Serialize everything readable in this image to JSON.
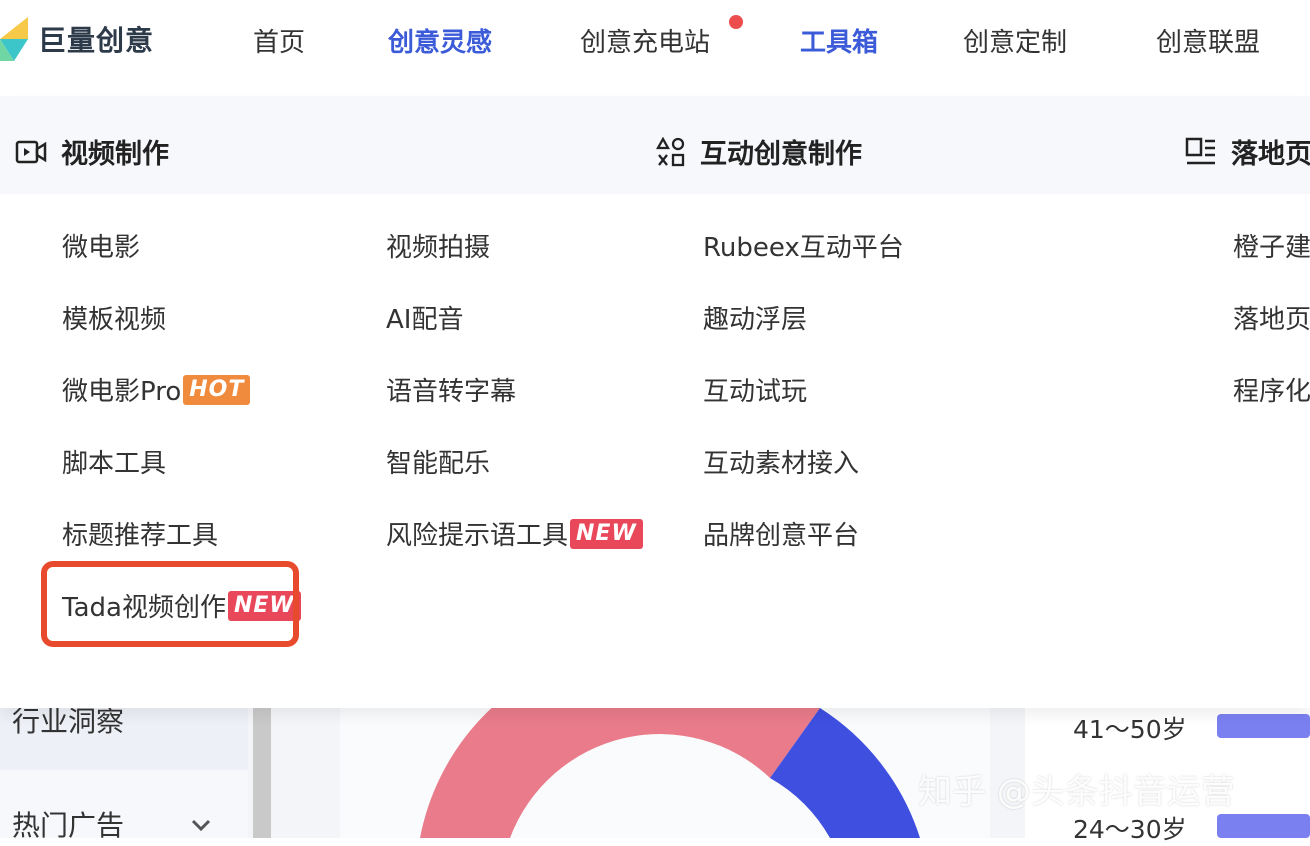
{
  "brand": {
    "name": "巨量创意"
  },
  "nav": [
    {
      "label": "首页",
      "active": false
    },
    {
      "label": "创意灵感",
      "active": true
    },
    {
      "label": "创意充电站",
      "active": false,
      "dot": true
    },
    {
      "label": "工具箱",
      "active": true
    },
    {
      "label": "创意定制",
      "active": false
    },
    {
      "label": "创意联盟",
      "active": false
    }
  ],
  "dropdown": {
    "categories": [
      {
        "label": "视频制作",
        "icon": "video-icon"
      },
      {
        "label": "互动创意制作",
        "icon": "shapes-icon"
      },
      {
        "label": "落地页",
        "icon": "layout-icon"
      }
    ],
    "col1": [
      {
        "label": "微电影"
      },
      {
        "label": "模板视频"
      },
      {
        "label": "微电影Pro",
        "badge": "HOT"
      },
      {
        "label": "脚本工具"
      },
      {
        "label": "标题推荐工具"
      },
      {
        "label": "Tada视频创作",
        "badge": "NEW"
      }
    ],
    "col2": [
      {
        "label": "视频拍摄"
      },
      {
        "label": "AI配音"
      },
      {
        "label": "语音转字幕"
      },
      {
        "label": "智能配乐"
      },
      {
        "label": "风险提示语工具",
        "badge": "NEW"
      }
    ],
    "col3": [
      {
        "label": "Rubeex互动平台"
      },
      {
        "label": "趣动浮层"
      },
      {
        "label": "互动试玩"
      },
      {
        "label": "互动素材接入"
      },
      {
        "label": "品牌创意平台"
      }
    ],
    "col4": [
      {
        "label": "橙子建"
      },
      {
        "label": "落地页"
      },
      {
        "label": "程序化"
      }
    ]
  },
  "background": {
    "sidebar": {
      "active_item": "行业洞察",
      "item2": "热门广告"
    },
    "age_labels": [
      "41～50岁",
      "24～30岁"
    ],
    "age_values_pct": [
      55,
      60
    ],
    "colors": {
      "donut_main": "#e97b8a",
      "donut_secondary": "#3f4fe0",
      "bar": "#7a80f0"
    }
  },
  "watermark": "知乎 @头条抖音运营",
  "colors": {
    "accent": "#3c5bd8",
    "highlight": "#e84a2e",
    "hot": "#f08a3c",
    "new": "#e9485a"
  }
}
